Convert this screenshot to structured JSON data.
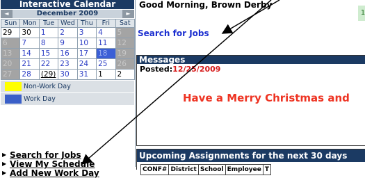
{
  "calendar": {
    "title": "Interactive Calendar",
    "month_label": "December 2009",
    "prev_arrow": "◄",
    "next_arrow": "►",
    "weekdays": [
      "Sun",
      "Mon",
      "Tue",
      "Wed",
      "Thu",
      "Fri",
      "Sat"
    ],
    "weeks": [
      [
        {
          "d": "29",
          "s": "pm"
        },
        {
          "d": "30",
          "s": "pm"
        },
        {
          "d": "1"
        },
        {
          "d": "2"
        },
        {
          "d": "3"
        },
        {
          "d": "4"
        },
        {
          "d": "5",
          "s": "off"
        }
      ],
      [
        {
          "d": "6",
          "s": "off"
        },
        {
          "d": "7"
        },
        {
          "d": "8"
        },
        {
          "d": "9"
        },
        {
          "d": "10"
        },
        {
          "d": "11"
        },
        {
          "d": "12",
          "s": "off"
        }
      ],
      [
        {
          "d": "13",
          "s": "off"
        },
        {
          "d": "14"
        },
        {
          "d": "15"
        },
        {
          "d": "16"
        },
        {
          "d": "17"
        },
        {
          "d": "18",
          "s": "today"
        },
        {
          "d": "19",
          "s": "off"
        }
      ],
      [
        {
          "d": "20",
          "s": "off"
        },
        {
          "d": "21"
        },
        {
          "d": "22"
        },
        {
          "d": "23"
        },
        {
          "d": "24"
        },
        {
          "d": "25"
        },
        {
          "d": "26",
          "s": "off"
        }
      ],
      [
        {
          "d": "27",
          "s": "off"
        },
        {
          "d": "28"
        },
        {
          "d": "(29)",
          "s": "sel"
        },
        {
          "d": "30"
        },
        {
          "d": "31"
        },
        {
          "d": "1",
          "s": "pm"
        },
        {
          "d": "2",
          "s": "pm"
        }
      ]
    ]
  },
  "legend": [
    {
      "label": "Non-Work Day",
      "color": "#ffff00"
    },
    {
      "label": "Work Day",
      "color": "#3a5fc8"
    }
  ],
  "nav": {
    "items": [
      "Search for Jobs",
      "View My Schedule",
      "Add New Work Day"
    ]
  },
  "header": {
    "greeting": "Good Morning, Brown Derby",
    "box_text": "1"
  },
  "search_link": "Search for Jobs",
  "messages": {
    "title": "Messages",
    "posted_label": "Posted:",
    "posted_date": "12/25/2009",
    "body": "Have a Merry Christmas and"
  },
  "assignments": {
    "title": "Upcoming Assignments for the next 30 days",
    "columns": [
      "CONF#",
      "District",
      "School",
      "Employee",
      "T"
    ]
  },
  "colors": {
    "header_bg": "#1b3a63",
    "link_blue": "#1c2fd0",
    "message_red": "#ee3322"
  }
}
